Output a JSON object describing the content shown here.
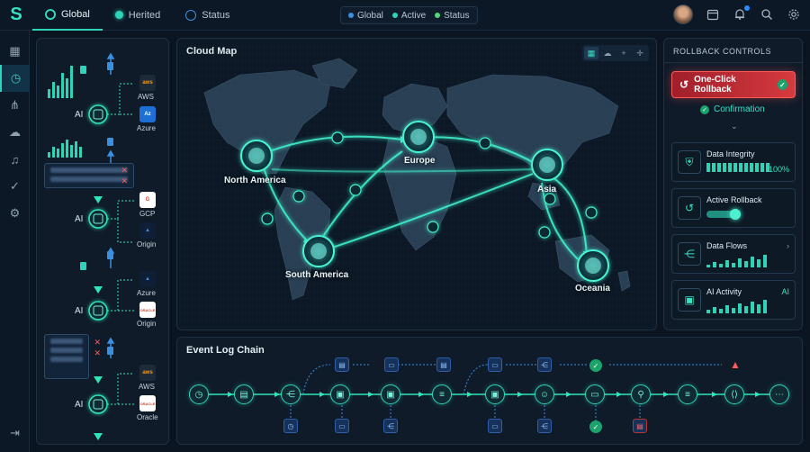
{
  "topbar": {
    "logo": "S",
    "tabs": [
      {
        "label": "Global",
        "icon": "globe-icon"
      },
      {
        "label": "Herited",
        "icon": "status-dot-icon"
      },
      {
        "label": "Status",
        "icon": "check-circle-icon"
      }
    ],
    "filters": [
      {
        "label": "Global",
        "color": "#3a8fe0"
      },
      {
        "label": "Active",
        "color": "#2fd4b8"
      },
      {
        "label": "Status",
        "color": "#4fd67a"
      }
    ],
    "icons": [
      "avatar",
      "calendar-icon",
      "bell-icon",
      "search-icon",
      "gear-icon"
    ]
  },
  "rail": {
    "items": [
      "dashboard-icon",
      "clock-icon",
      "network-icon",
      "cloud-icon",
      "bell-icon",
      "check-icon",
      "gear-icon",
      "logout-icon"
    ]
  },
  "pipeline": {
    "ai_label": "AI",
    "clouds": [
      {
        "label": "AWS",
        "badge": "aws",
        "color": "#ff9900",
        "bg": "#1d2a3a"
      },
      {
        "label": "Azure",
        "badge": "Az",
        "color": "#ffffff",
        "bg": "#1d6fd6"
      },
      {
        "label": "GCP",
        "badge": "G",
        "color": "#ea4335",
        "bg": "#ffffff"
      },
      {
        "label": "Origin",
        "badge": "▲",
        "color": "#3a8fe0",
        "bg": "#0f2036"
      },
      {
        "label": "Azure",
        "badge": "▲",
        "color": "#3a8fe0",
        "bg": "#0f2036"
      },
      {
        "label": "Origin",
        "badge": "ORACLE",
        "color": "#c74634",
        "bg": "#ffffff"
      },
      {
        "label": "AWS",
        "badge": "aws",
        "color": "#ff9900",
        "bg": "#1d2a3a"
      },
      {
        "label": "Oracle",
        "badge": "ORACLE",
        "color": "#c74634",
        "bg": "#ffffff"
      }
    ]
  },
  "map": {
    "title": "Cloud Map",
    "regions": [
      "North America",
      "Europe",
      "Asia",
      "South America",
      "Oceania"
    ]
  },
  "rollback": {
    "header": "ROLLBACK CONTROLS",
    "button_label": "One-Click Rollback",
    "confirmation": "Confirmation",
    "cards": {
      "integrity": {
        "title": "Data Integrity",
        "value": "100%",
        "progress": 1.0
      },
      "active": {
        "title": "Active Rollback",
        "toggle_on": true
      },
      "flows": {
        "title": "Data Flows"
      },
      "ai": {
        "title": "AI Activity",
        "value": "AI"
      }
    }
  },
  "event_log": {
    "title": "Event Log Chain"
  },
  "colors": {
    "accent": "#2fd4b8",
    "danger": "#e04040",
    "ok": "#1aa36b"
  }
}
